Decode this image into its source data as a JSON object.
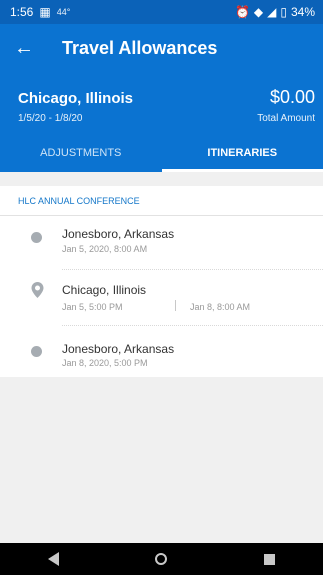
{
  "status_bar": {
    "time": "1:56",
    "left_icon": "sim-card-icon",
    "temp": "44°",
    "battery": "34%"
  },
  "app_bar": {
    "title": "Travel Allowances"
  },
  "summary": {
    "city": "Chicago, Illinois",
    "dates": "1/5/20 - 1/8/20",
    "amount": "$0.00",
    "amount_label": "Total Amount"
  },
  "tabs": [
    {
      "label": "ADJUSTMENTS",
      "active": false
    },
    {
      "label": "ITINERARIES",
      "active": true
    }
  ],
  "section": {
    "title": "HLC ANNUAL CONFERENCE"
  },
  "itinerary": [
    {
      "place": "Jonesboro, Arkansas",
      "time": "Jan 5, 2020, 8:00 AM",
      "marker": "dot"
    },
    {
      "place": "Chicago, Illinois",
      "time_start": "Jan 5, 5:00 PM",
      "time_end": "Jan 8, 8:00 AM",
      "marker": "pin"
    },
    {
      "place": "Jonesboro, Arkansas",
      "time": "Jan 8, 2020, 5:00 PM",
      "marker": "dot"
    }
  ],
  "navigation": {
    "back": "back-icon",
    "home": "home-icon",
    "recent": "recent-apps-icon"
  },
  "colors": {
    "primary": "#0b73d1",
    "status_bar": "#0b62b8",
    "section": "#1477c9",
    "marker": "#a6acb2"
  }
}
